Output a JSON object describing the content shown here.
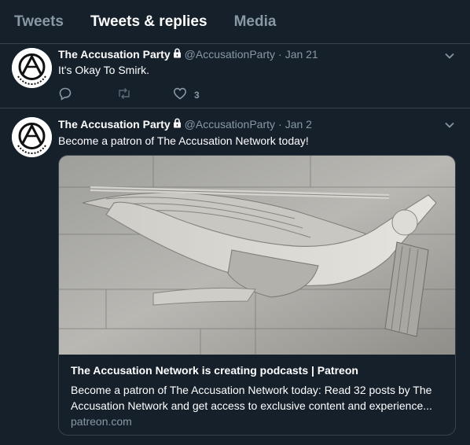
{
  "tabs": [
    {
      "label": "Tweets",
      "active": false
    },
    {
      "label": "Tweets & replies",
      "active": true
    },
    {
      "label": "Media",
      "active": false
    }
  ],
  "tweets": [
    {
      "name": "The Accusation Party",
      "handle": "@AccusationParty",
      "separator": "·",
      "date": "Jan 21",
      "text": "It's Okay To Smirk.",
      "likes": "3"
    },
    {
      "name": "The Accusation Party",
      "handle": "@AccusationParty",
      "separator": "·",
      "date": "Jan 2",
      "text": "Become a patron of The Accusation Network today!",
      "card": {
        "title": "The Accusation Network is creating podcasts | Patreon",
        "description": "Become a patron of The Accusation Network today: Read 32 posts by The Accusation Network and get access to exclusive content and experience...",
        "domain": "patreon.com"
      }
    }
  ],
  "colors": {
    "background": "#15202b",
    "border": "#38444d",
    "secondary_text": "#8899a6"
  },
  "icons": [
    "lock-icon",
    "chevron-down-icon",
    "reply-icon",
    "retweet-icon",
    "like-icon"
  ]
}
